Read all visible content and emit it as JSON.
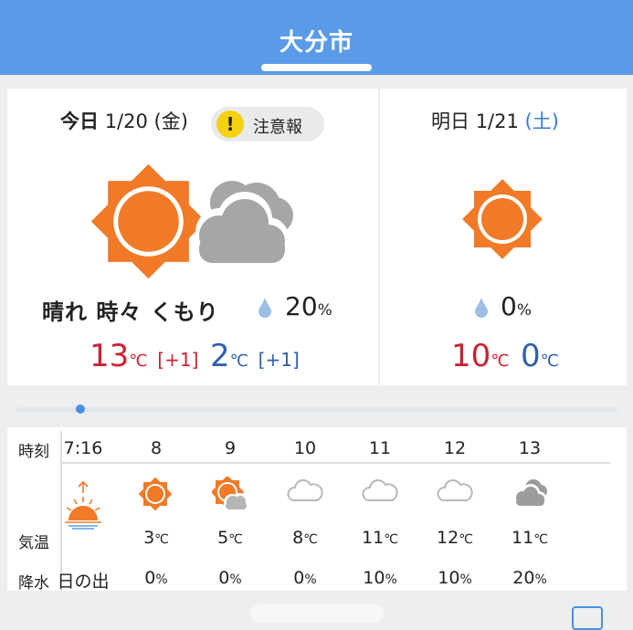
{
  "header": {
    "title": "大分市"
  },
  "today": {
    "label": "今日",
    "date": "1/20",
    "weekday": "(金)",
    "warning": "注意報",
    "warning_icon": "!",
    "condition": "晴れ 時々 くもり",
    "precip": "20",
    "precip_unit": "%",
    "high": "13",
    "high_diff": "[+1]",
    "low": "2",
    "low_diff": "[+1]",
    "temp_unit": "℃",
    "icons": [
      "sun-icon",
      "cloud-icon"
    ]
  },
  "tomorrow": {
    "label": "明日",
    "date": "1/21",
    "weekday": "(土)",
    "precip": "0",
    "precip_unit": "%",
    "high": "10",
    "low": "0",
    "temp_unit": "℃",
    "icons": [
      "sun-icon"
    ]
  },
  "hourly": {
    "labels": {
      "time": "時刻",
      "temp": "気温",
      "precip": "降水"
    },
    "hours": [
      {
        "time": "7:16",
        "icon": "sunrise-icon",
        "temp": "",
        "precip": "日の出"
      },
      {
        "time": "8",
        "icon": "sun-icon",
        "temp": "3",
        "precip": "0"
      },
      {
        "time": "9",
        "icon": "sun-cloud-icon",
        "temp": "5",
        "precip": "0"
      },
      {
        "time": "10",
        "icon": "cloud-icon",
        "temp": "8",
        "precip": "0"
      },
      {
        "time": "11",
        "icon": "cloud-icon",
        "temp": "11",
        "precip": "10"
      },
      {
        "time": "12",
        "icon": "cloud-icon",
        "temp": "12",
        "precip": "10"
      },
      {
        "time": "13",
        "icon": "cloud-gray-icon",
        "temp": "11",
        "precip": "20"
      }
    ],
    "temp_unit": "℃",
    "precip_unit": "%"
  },
  "colors": {
    "header": "#5a9be8",
    "sun": "#f07a28",
    "high": "#cc2233",
    "low": "#2f5fae",
    "warning": "#f6d10f"
  }
}
